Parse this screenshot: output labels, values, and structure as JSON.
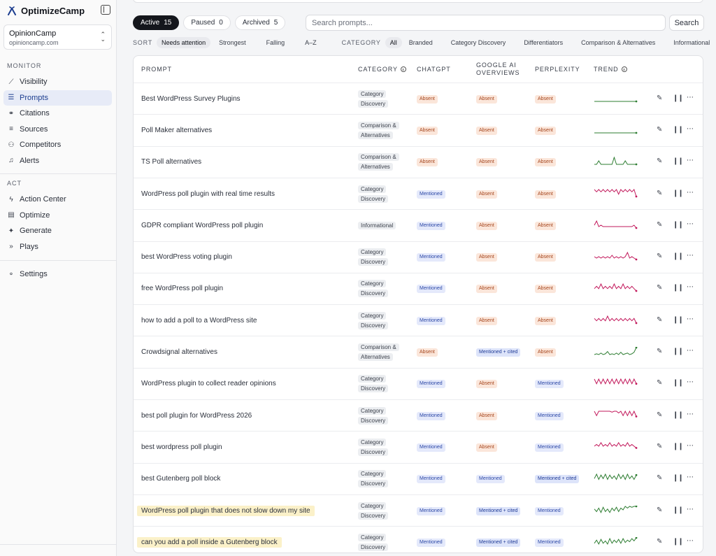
{
  "app": {
    "name": "OptimizeCamp"
  },
  "workspace": {
    "name": "OpinionCamp",
    "domain": "opinioncamp.com"
  },
  "sidebar": {
    "monitor_label": "MONITOR",
    "monitor": [
      {
        "label": "Visibility",
        "icon": "chart-line-icon"
      },
      {
        "label": "Prompts",
        "icon": "list-icon",
        "active": true
      },
      {
        "label": "Citations",
        "icon": "link-icon"
      },
      {
        "label": "Sources",
        "icon": "list-lines-icon"
      },
      {
        "label": "Competitors",
        "icon": "users-icon"
      },
      {
        "label": "Alerts",
        "icon": "bell-icon"
      }
    ],
    "act_label": "ACT",
    "act": [
      {
        "label": "Action Center",
        "icon": "bolt-icon"
      },
      {
        "label": "Optimize",
        "icon": "document-icon"
      },
      {
        "label": "Generate",
        "icon": "sparkle-icon"
      },
      {
        "label": "Plays",
        "icon": "double-chevron-icon"
      }
    ],
    "settings": {
      "label": "Settings",
      "icon": "gear-icon"
    }
  },
  "status_tabs": [
    {
      "label": "Active",
      "count": "15",
      "active": true
    },
    {
      "label": "Paused",
      "count": "0"
    },
    {
      "label": "Archived",
      "count": "5"
    }
  ],
  "search": {
    "placeholder": "Search prompts...",
    "button": "Search"
  },
  "sort": {
    "label": "SORT",
    "options": [
      "Needs attention",
      "Strongest",
      "Falling",
      "A–Z"
    ],
    "active": 0
  },
  "category_filter": {
    "label": "CATEGORY",
    "options": [
      "All",
      "Branded",
      "Category Discovery",
      "Differentiators",
      "Comparison & Alternatives",
      "Informational"
    ],
    "active": 0
  },
  "table": {
    "headers": {
      "prompt": "PROMPT",
      "category": "CATEGORY",
      "chatgpt": "CHATGPT",
      "google": "GOOGLE AI OVERVIEWS",
      "perplexity": "PERPLEXITY",
      "trend": "TREND"
    },
    "colors": {
      "trend_up": "#2e7d32",
      "trend_down": "#c2185b"
    },
    "rows": [
      {
        "prompt": "Best WordPress Survey Plugins",
        "category": "Category Discovery",
        "chatgpt": "Absent",
        "google": "Absent",
        "perplexity": "Absent",
        "trend": [
          0,
          0,
          0,
          0,
          0,
          0,
          0,
          0,
          0,
          0,
          0,
          0,
          0,
          0,
          0,
          0,
          0,
          0,
          0,
          0
        ],
        "trend_dir": "up"
      },
      {
        "prompt": "Poll Maker alternatives",
        "category": "Comparison & Alternatives",
        "chatgpt": "Absent",
        "google": "Absent",
        "perplexity": "Absent",
        "trend": [
          0,
          0,
          0,
          0,
          0,
          0,
          0,
          0,
          0,
          0,
          0,
          0,
          0,
          0,
          0,
          0,
          0,
          0,
          0,
          0
        ],
        "trend_dir": "up"
      },
      {
        "prompt": "TS Poll alternatives",
        "category": "Comparison & Alternatives",
        "chatgpt": "Absent",
        "google": "Absent",
        "perplexity": "Absent",
        "trend": [
          0,
          0,
          1,
          0,
          0,
          0,
          0,
          0,
          0,
          2,
          0,
          0,
          0,
          0,
          1,
          0,
          0,
          0,
          0,
          0
        ],
        "trend_dir": "up"
      },
      {
        "prompt": "WordPress poll plugin with real time results",
        "category": "Category Discovery",
        "chatgpt": "Mentioned",
        "google": "Absent",
        "perplexity": "Absent",
        "trend": [
          3,
          2,
          3,
          2,
          3,
          2,
          3,
          2,
          3,
          2,
          3,
          1,
          3,
          2,
          3,
          2,
          3,
          2,
          3,
          0
        ],
        "trend_dir": "down"
      },
      {
        "prompt": "GDPR compliant WordPress poll plugin",
        "category": "Informational",
        "chatgpt": "Mentioned",
        "google": "Absent",
        "perplexity": "Absent",
        "trend": [
          2,
          5,
          1,
          2,
          1,
          1,
          1,
          1,
          1,
          1,
          1,
          1,
          1,
          1,
          1,
          1,
          1,
          1,
          2,
          0
        ],
        "trend_dir": "down"
      },
      {
        "prompt": "best WordPress voting plugin",
        "category": "Category Discovery",
        "chatgpt": "Mentioned",
        "google": "Absent",
        "perplexity": "Absent",
        "trend": [
          2,
          1,
          2,
          1,
          2,
          1,
          2,
          1,
          3,
          1,
          2,
          1,
          2,
          1,
          2,
          5,
          1,
          2,
          1,
          0
        ],
        "trend_dir": "down"
      },
      {
        "prompt": "free WordPress poll plugin",
        "category": "Category Discovery",
        "chatgpt": "Mentioned",
        "google": "Absent",
        "perplexity": "Absent",
        "trend": [
          1,
          2,
          1,
          3,
          1,
          2,
          1,
          2,
          1,
          3,
          1,
          2,
          1,
          3,
          1,
          2,
          1,
          2,
          1,
          0
        ],
        "trend_dir": "down"
      },
      {
        "prompt": "how to add a poll to a WordPress site",
        "category": "Category Discovery",
        "chatgpt": "Mentioned",
        "google": "Absent",
        "perplexity": "Absent",
        "trend": [
          2,
          1,
          2,
          1,
          2,
          1,
          3,
          1,
          2,
          1,
          2,
          1,
          2,
          1,
          2,
          1,
          2,
          1,
          2,
          0
        ],
        "trend_dir": "down"
      },
      {
        "prompt": "Crowdsignal alternatives",
        "category": "Comparison & Alternatives",
        "chatgpt": "Absent",
        "google": "Mentioned + cited",
        "perplexity": "Absent",
        "trend": [
          0,
          1,
          0,
          2,
          0,
          1,
          4,
          0,
          1,
          0,
          2,
          0,
          3,
          0,
          1,
          2,
          0,
          1,
          3,
          9
        ],
        "trend_dir": "up"
      },
      {
        "prompt": "WordPress plugin to collect reader opinions",
        "category": "Category Discovery",
        "chatgpt": "Mentioned",
        "google": "Absent",
        "perplexity": "Mentioned",
        "trend": [
          6,
          2,
          6,
          2,
          6,
          2,
          6,
          2,
          6,
          2,
          6,
          2,
          6,
          2,
          6,
          2,
          6,
          2,
          6,
          2
        ],
        "trend_dir": "down"
      },
      {
        "prompt": "best poll plugin for WordPress 2026",
        "category": "Category Discovery",
        "chatgpt": "Mentioned",
        "google": "Absent",
        "perplexity": "Mentioned",
        "trend": [
          8,
          3,
          8,
          8,
          8,
          8,
          8,
          8,
          7,
          8,
          8,
          6,
          8,
          3,
          8,
          3,
          8,
          3,
          8,
          2
        ],
        "trend_dir": "down"
      },
      {
        "prompt": "best wordpress poll plugin",
        "category": "Category Discovery",
        "chatgpt": "Mentioned",
        "google": "Absent",
        "perplexity": "Mentioned",
        "trend": [
          2,
          3,
          2,
          4,
          2,
          3,
          2,
          4,
          2,
          3,
          2,
          4,
          2,
          3,
          2,
          4,
          2,
          3,
          2,
          1
        ],
        "trend_dir": "down"
      },
      {
        "prompt": "best Gutenberg poll block",
        "category": "Category Discovery",
        "chatgpt": "Mentioned",
        "google": "Mentioned",
        "perplexity": "Mentioned + cited",
        "trend": [
          3,
          8,
          2,
          7,
          3,
          8,
          2,
          7,
          3,
          6,
          2,
          8,
          3,
          7,
          2,
          8,
          3,
          6,
          2,
          7
        ],
        "trend_dir": "up"
      },
      {
        "prompt": "WordPress poll plugin that does not slow down my site",
        "category": "Category Discovery",
        "chatgpt": "Mentioned",
        "google": "Mentioned + cited",
        "perplexity": "Mentioned",
        "trend": [
          5,
          2,
          6,
          1,
          7,
          2,
          5,
          1,
          6,
          3,
          7,
          2,
          6,
          4,
          8,
          6,
          8,
          7,
          8,
          8
        ],
        "trend_dir": "up",
        "highlight": true
      },
      {
        "prompt": "can you add a poll inside a Gutenberg block",
        "category": "Category Discovery",
        "chatgpt": "Mentioned",
        "google": "Mentioned + cited",
        "perplexity": "Mentioned",
        "trend": [
          2,
          6,
          1,
          7,
          2,
          5,
          1,
          8,
          2,
          6,
          3,
          7,
          2,
          8,
          3,
          6,
          4,
          8,
          5,
          9
        ],
        "trend_dir": "up",
        "highlight": true
      }
    ]
  }
}
